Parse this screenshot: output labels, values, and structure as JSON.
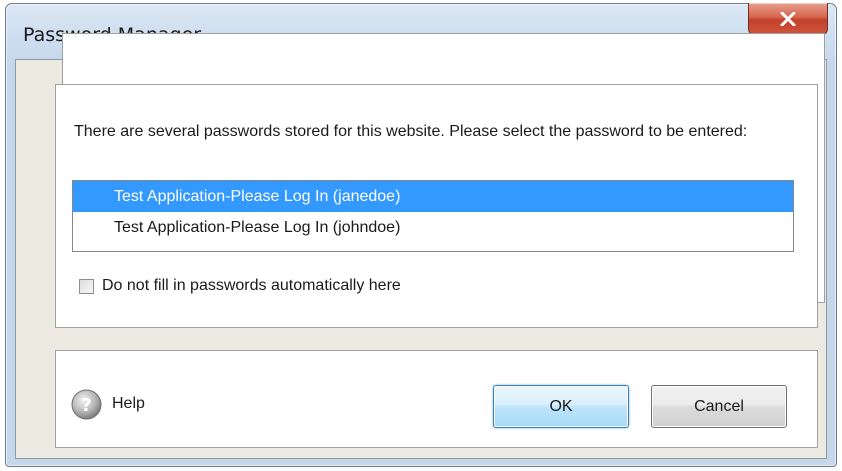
{
  "window": {
    "title": "Password Manager"
  },
  "message": "There are several passwords stored for this website. Please select the password to be entered:",
  "passwords": [
    {
      "label": "Test Application-Please Log In (janedoe)",
      "selected": true
    },
    {
      "label": "Test Application-Please Log In (johndoe)",
      "selected": false
    }
  ],
  "checkbox": {
    "label": "Do not fill in passwords automatically here",
    "checked": false
  },
  "footer": {
    "help_label": "Help",
    "ok_label": "OK",
    "cancel_label": "Cancel"
  },
  "icons": {
    "close": "close-icon",
    "help": "help-icon"
  },
  "colors": {
    "selection": "#3399ff",
    "close_button": "#c8472f",
    "dialog_background": "#ece9e1"
  }
}
